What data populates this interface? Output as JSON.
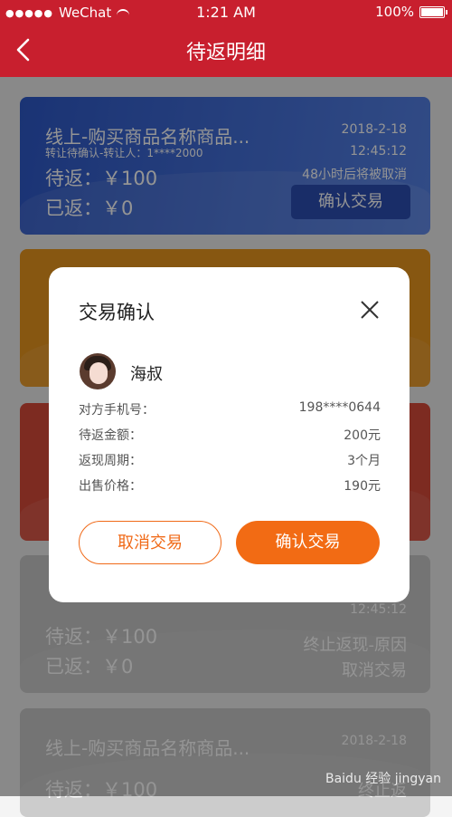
{
  "status_bar": {
    "carrier": "WeChat",
    "time": "1:21 AM",
    "battery": "100%"
  },
  "navbar": {
    "title": "待返明细"
  },
  "cards": [
    {
      "title": "线上-购买商品名称商品...",
      "subtitle": "转让待确认-转让人：1****2000",
      "pending": "待返：￥100",
      "returned": "已返：￥0",
      "date": "2018-2-18",
      "time": "12:45:12",
      "warning": "48小时后将被取消",
      "button": "确认交易"
    },
    {
      "pending": "待返：￥100",
      "returned": "已返：￥0",
      "time": "12:45:12",
      "status_line1": "终止返现-原因",
      "status_line2": "取消交易"
    },
    {
      "title": "线上-购买商品名称商品...",
      "date": "2018-2-18",
      "pending": "待返：￥100",
      "status_line1": "终止返"
    }
  ],
  "modal": {
    "title": "交易确认",
    "user_name": "海叔",
    "rows": [
      {
        "label": "对方手机号：",
        "value": "198****0644"
      },
      {
        "label": "待返金额：",
        "value": "200元"
      },
      {
        "label": "返现周期：",
        "value": "3个月"
      },
      {
        "label": "出售价格：",
        "value": "190元"
      }
    ],
    "cancel_label": "取消交易",
    "confirm_label": "确认交易"
  },
  "watermark": "Baidu 经验 jingyan"
}
